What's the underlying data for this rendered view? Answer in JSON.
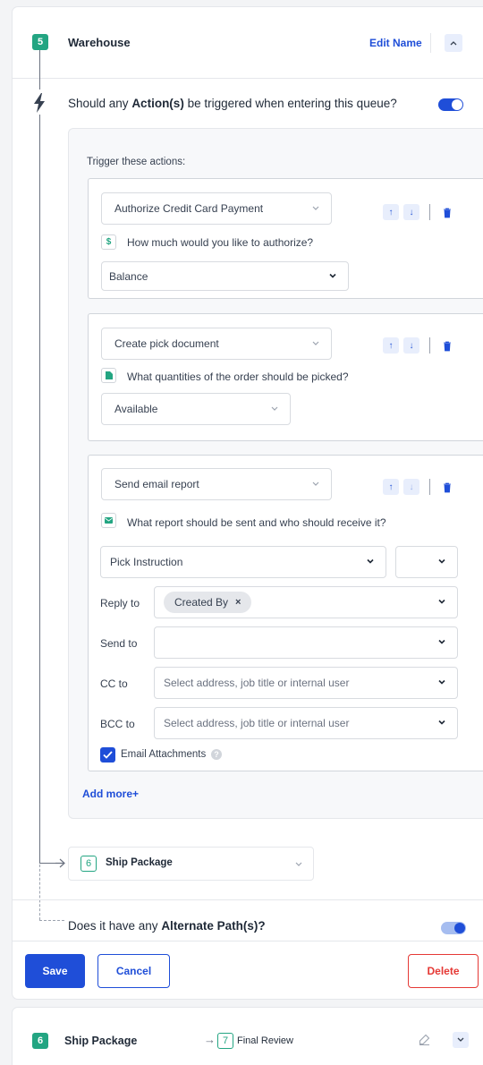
{
  "queue": {
    "number": "5",
    "name": "Warehouse",
    "edit_name": "Edit Name"
  },
  "trigger_question": {
    "prefix": "Should any ",
    "bold": "Action(s)",
    "suffix": " be triggered when entering this queue?",
    "enabled": true
  },
  "trigger_label": "Trigger these actions:",
  "actions": [
    {
      "select": "Authorize Credit Card Payment",
      "question": "How much would you like to authorize?",
      "icon": "dollar-icon",
      "answer": "Balance"
    },
    {
      "select": "Create pick document",
      "question": "What quantities of the order should be picked?",
      "icon": "document-icon",
      "answer": "Available"
    },
    {
      "select": "Send email report",
      "question": "What report should be sent and who should receive it?",
      "icon": "email-icon",
      "report": "Pick Instruction"
    }
  ],
  "email": {
    "reply_label": "Reply to",
    "reply_chip": "Created By",
    "send_label": "Send to",
    "cc_label": "CC to",
    "cc_placeholder": "Select address, job title or internal user",
    "bcc_label": "BCC to",
    "bcc_placeholder": "Select address, job title or internal user",
    "attachments_label": "Email Attachments",
    "attachments_checked": true
  },
  "add_more": "Add more",
  "next_queue": {
    "number": "6",
    "name": "Ship Package"
  },
  "alternate": {
    "prefix": "Does it have any ",
    "bold": "Alternate Path(s)?",
    "enabled": false
  },
  "buttons": {
    "save": "Save",
    "cancel": "Cancel",
    "delete": "Delete"
  },
  "bottom_row": {
    "number": "6",
    "name": "Ship Package",
    "next_number": "7",
    "next_name": "Final Review"
  },
  "colors": {
    "primary": "#1f4ed8",
    "green": "#23a582",
    "danger": "#e53935"
  }
}
